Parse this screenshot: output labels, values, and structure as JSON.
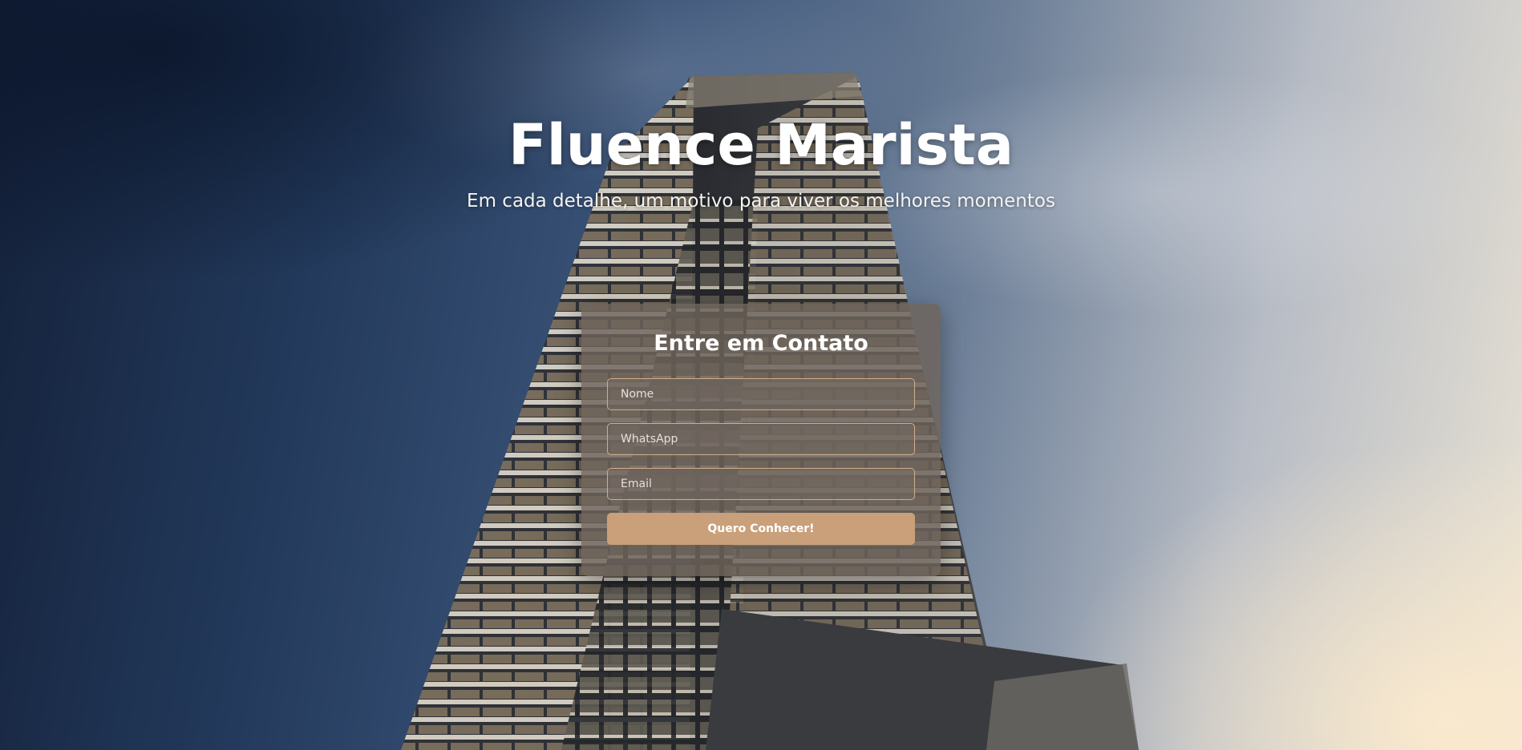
{
  "hero": {
    "title": "Fluence Marista",
    "subtitle": "Em cada detalhe, um motivo para viver os melhores momentos"
  },
  "contact_form": {
    "title": "Entre em Contato",
    "fields": {
      "name_placeholder": "Nome",
      "whatsapp_placeholder": "WhatsApp",
      "email_placeholder": "Email"
    },
    "submit_label": "Quero Conhecer!"
  },
  "colors": {
    "accent": "#c9a07a",
    "field_border": "#cfae88",
    "card_background": "#6e645c",
    "text": "#ffffff"
  }
}
